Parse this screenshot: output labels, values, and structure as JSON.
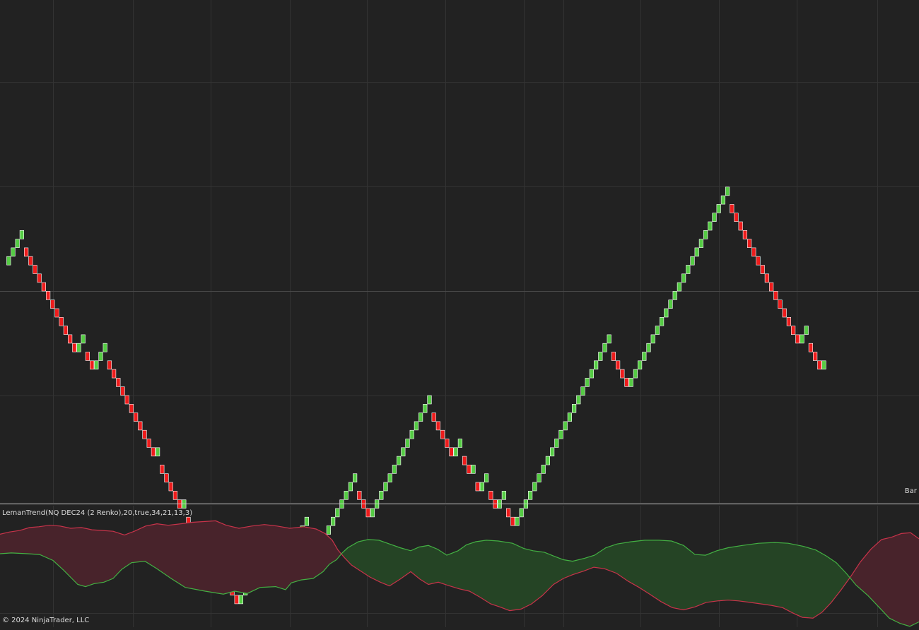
{
  "indicator": {
    "label": "LemanTrend(NQ DEC24 (2 Renko),20,true,34,21,13,3)"
  },
  "price_panel": {
    "bar_label": "Bar t"
  },
  "footer": {
    "copyright": "© 2024 NinjaTrader, LLC"
  },
  "colors": {
    "background": "#222222",
    "grid": "#333333",
    "separator": "#c8c8c8",
    "up_brick": "#55cc44",
    "down_brick": "#ee1c1c",
    "brick_outline": "#ffffff",
    "bull_line": "#43b043",
    "bear_line": "#c8334a",
    "bull_fill": "#254425",
    "bear_fill": "#48232b"
  },
  "chart_data": [
    {
      "type": "renko",
      "instrument": "NQ DEC24 (2 Renko)",
      "brick_directions": "UUUUDDDDDDDDDDDDUUDDUUUDDDDDDDDDDDUDDDDDUDDDDDDUUDDDDUUUUUUDDUUUUUUUUDDUUUUUUUUUDDDUUUUUUUUUUUUUUDDDDDUUDDUDUUDDUUDDUUUUUUUUUUUUUUUUUUUUUUDDDDUUUUUUUUUUUUUUUUUUUUUUUDDDDDDDDDDDDDDDDUUDDDU",
      "grid": true
    },
    {
      "type": "area",
      "name": "LemanTrend(NQ DEC24 (2 Renko),20,true,34,21,13,3)",
      "grid": true,
      "green_series": [
        [
          0,
          0
        ],
        [
          16,
          1
        ],
        [
          39,
          0
        ],
        [
          56,
          -1
        ],
        [
          75,
          -9
        ],
        [
          90,
          -22
        ],
        [
          110,
          -41
        ],
        [
          121,
          -44
        ],
        [
          133,
          -40
        ],
        [
          147,
          -38
        ],
        [
          160,
          -33
        ],
        [
          172,
          -21
        ],
        [
          186,
          -12
        ],
        [
          205,
          -10
        ],
        [
          222,
          -20
        ],
        [
          242,
          -33
        ],
        [
          262,
          -45
        ],
        [
          290,
          -50
        ],
        [
          316,
          -54
        ],
        [
          332,
          -50
        ],
        [
          350,
          -53
        ],
        [
          368,
          -45
        ],
        [
          390,
          -44
        ],
        [
          404,
          -48
        ],
        [
          412,
          -39
        ],
        [
          426,
          -35
        ],
        [
          443,
          -33
        ],
        [
          457,
          -24
        ],
        [
          466,
          -14
        ],
        [
          476,
          -8
        ],
        [
          484,
          1
        ],
        [
          492,
          8
        ],
        [
          507,
          16
        ],
        [
          521,
          19
        ],
        [
          536,
          18
        ],
        [
          551,
          13
        ],
        [
          566,
          8
        ],
        [
          581,
          4
        ],
        [
          593,
          9
        ],
        [
          606,
          11
        ],
        [
          619,
          6
        ],
        [
          632,
          -2
        ],
        [
          648,
          4
        ],
        [
          660,
          12
        ],
        [
          673,
          16
        ],
        [
          688,
          18
        ],
        [
          705,
          17
        ],
        [
          725,
          14
        ],
        [
          741,
          7
        ],
        [
          754,
          4
        ],
        [
          770,
          2
        ],
        [
          783,
          -3
        ],
        [
          797,
          -8
        ],
        [
          810,
          -10
        ],
        [
          827,
          -6
        ],
        [
          841,
          -2
        ],
        [
          857,
          8
        ],
        [
          873,
          13
        ],
        [
          893,
          16
        ],
        [
          912,
          18
        ],
        [
          932,
          18
        ],
        [
          950,
          17
        ],
        [
          967,
          11
        ],
        [
          983,
          -1
        ],
        [
          998,
          -2
        ],
        [
          1014,
          4
        ],
        [
          1030,
          8
        ],
        [
          1050,
          11
        ],
        [
          1073,
          14
        ],
        [
          1096,
          15
        ],
        [
          1115,
          14
        ],
        [
          1136,
          10
        ],
        [
          1154,
          5
        ],
        [
          1169,
          -3
        ],
        [
          1183,
          -12
        ],
        [
          1197,
          -26
        ],
        [
          1211,
          -42
        ],
        [
          1228,
          -56
        ],
        [
          1244,
          -72
        ],
        [
          1258,
          -86
        ],
        [
          1273,
          -93
        ],
        [
          1287,
          -97
        ],
        [
          1300,
          -91
        ]
      ],
      "red_series": [
        [
          0,
          26
        ],
        [
          13,
          29
        ],
        [
          28,
          31
        ],
        [
          42,
          35
        ],
        [
          55,
          36
        ],
        [
          70,
          38
        ],
        [
          85,
          37
        ],
        [
          100,
          34
        ],
        [
          115,
          35
        ],
        [
          130,
          32
        ],
        [
          145,
          31
        ],
        [
          160,
          30
        ],
        [
          176,
          25
        ],
        [
          190,
          30
        ],
        [
          206,
          37
        ],
        [
          222,
          40
        ],
        [
          238,
          38
        ],
        [
          256,
          40
        ],
        [
          272,
          42
        ],
        [
          290,
          43
        ],
        [
          305,
          44
        ],
        [
          320,
          38
        ],
        [
          338,
          34
        ],
        [
          356,
          37
        ],
        [
          374,
          39
        ],
        [
          392,
          37
        ],
        [
          410,
          34
        ],
        [
          430,
          36
        ],
        [
          447,
          33
        ],
        [
          460,
          27
        ],
        [
          470,
          18
        ],
        [
          478,
          5
        ],
        [
          487,
          -5
        ],
        [
          497,
          -15
        ],
        [
          510,
          -23
        ],
        [
          523,
          -31
        ],
        [
          538,
          -38
        ],
        [
          551,
          -43
        ],
        [
          566,
          -34
        ],
        [
          581,
          -24
        ],
        [
          594,
          -34
        ],
        [
          606,
          -41
        ],
        [
          620,
          -38
        ],
        [
          636,
          -43
        ],
        [
          650,
          -47
        ],
        [
          664,
          -50
        ],
        [
          679,
          -58
        ],
        [
          694,
          -67
        ],
        [
          707,
          -71
        ],
        [
          721,
          -76
        ],
        [
          737,
          -74
        ],
        [
          752,
          -67
        ],
        [
          767,
          -56
        ],
        [
          783,
          -41
        ],
        [
          797,
          -33
        ],
        [
          810,
          -28
        ],
        [
          826,
          -23
        ],
        [
          840,
          -18
        ],
        [
          855,
          -20
        ],
        [
          872,
          -26
        ],
        [
          889,
          -37
        ],
        [
          904,
          -45
        ],
        [
          919,
          -54
        ],
        [
          935,
          -64
        ],
        [
          951,
          -72
        ],
        [
          967,
          -75
        ],
        [
          983,
          -71
        ],
        [
          999,
          -65
        ],
        [
          1015,
          -63
        ],
        [
          1030,
          -62
        ],
        [
          1045,
          -63
        ],
        [
          1061,
          -65
        ],
        [
          1076,
          -67
        ],
        [
          1091,
          -69
        ],
        [
          1107,
          -72
        ],
        [
          1121,
          -79
        ],
        [
          1135,
          -85
        ],
        [
          1150,
          -86
        ],
        [
          1163,
          -78
        ],
        [
          1176,
          -65
        ],
        [
          1190,
          -48
        ],
        [
          1203,
          -31
        ],
        [
          1217,
          -11
        ],
        [
          1232,
          6
        ],
        [
          1247,
          19
        ],
        [
          1261,
          22
        ],
        [
          1275,
          27
        ],
        [
          1288,
          28
        ],
        [
          1300,
          20
        ]
      ]
    }
  ]
}
